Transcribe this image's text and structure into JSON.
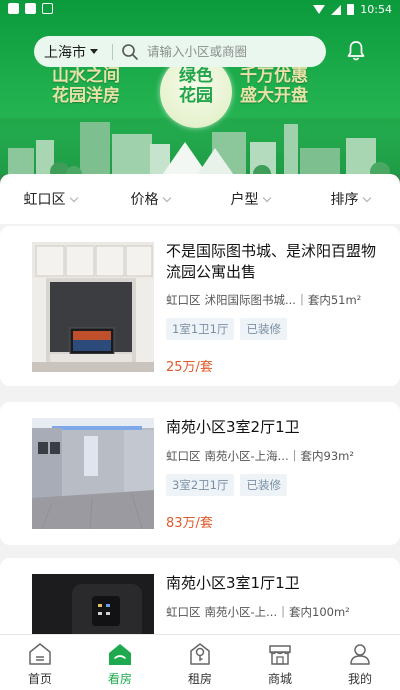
{
  "status_bar": {
    "time": "10:54"
  },
  "header": {
    "city": "上海市",
    "search_placeholder": "请输入小区或商圈"
  },
  "banner": {
    "slogan_left": [
      "山水之间",
      "花园洋房"
    ],
    "badge": [
      "绿色",
      "花园"
    ],
    "slogan_right": [
      "千万优惠",
      "盛大开盘"
    ]
  },
  "filters": [
    {
      "label": "虹口区"
    },
    {
      "label": "价格"
    },
    {
      "label": "户型"
    },
    {
      "label": "排序"
    }
  ],
  "listings": [
    {
      "title": "不是国际图书城、是沭阳百盟物流园公寓出售",
      "district": "虹口区",
      "location": "沭阳国际图书城...",
      "area": "套内51m²",
      "tags": [
        "1室1卫1厅",
        "已装修"
      ],
      "price": "25万/套"
    },
    {
      "title": "南苑小区3室2厅1卫",
      "district": "虹口区",
      "location": "南苑小区-上海...",
      "area": "套内93m²",
      "tags": [
        "3室2卫1厅",
        "已装修"
      ],
      "price": "83万/套"
    },
    {
      "title": "南苑小区3室1厅1卫",
      "district": "虹口区",
      "location": "南苑小区-上...",
      "area": "套内100m²",
      "tags": [],
      "price": ""
    }
  ],
  "bottom_nav": [
    {
      "label": "首页",
      "icon": "home-icon",
      "active": false
    },
    {
      "label": "看房",
      "icon": "house-view-icon",
      "active": true
    },
    {
      "label": "租房",
      "icon": "rent-key-icon",
      "active": false
    },
    {
      "label": "商城",
      "icon": "shop-icon",
      "active": false
    },
    {
      "label": "我的",
      "icon": "profile-icon",
      "active": false
    }
  ],
  "colors": {
    "brand_green": "#1ea94e",
    "price": "#e05a2b",
    "tag_text": "#7b8fa3"
  }
}
